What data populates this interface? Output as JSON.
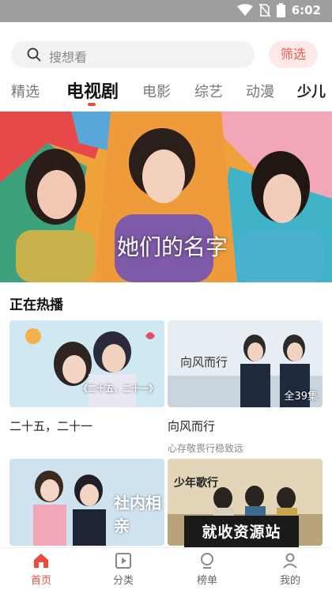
{
  "status_bar": {
    "time": "6:02"
  },
  "search": {
    "placeholder": "搜想看",
    "filter_label": "筛选"
  },
  "tabs": [
    "精选",
    "电视剧",
    "电影",
    "综艺",
    "动漫",
    "少儿"
  ],
  "active_tab": "电视剧",
  "banner": {
    "title_text": "她们的名字"
  },
  "section": {
    "title": "正在热播"
  },
  "cards": [
    {
      "title": "二十五，二十一",
      "subtitle": "",
      "poster_text": "《二十五，二十一》",
      "badge": ""
    },
    {
      "title": "向风而行",
      "subtitle": "心存敬畏行稳致远",
      "poster_text": "向风而行",
      "badge": "全39集"
    },
    {
      "title": "",
      "subtitle": "",
      "poster_text": "社内相亲",
      "badge": ""
    },
    {
      "title": "",
      "subtitle": "",
      "poster_text": "少年歌行",
      "badge": ""
    }
  ],
  "watermark": "就收资源站",
  "bottom_nav": [
    {
      "label": "首页",
      "icon": "home-icon",
      "active": true
    },
    {
      "label": "分类",
      "icon": "category-icon",
      "active": false
    },
    {
      "label": "榜单",
      "icon": "ranking-icon",
      "active": false
    },
    {
      "label": "我的",
      "icon": "profile-icon",
      "active": false
    }
  ],
  "colors": {
    "accent": "#ec4b3f",
    "status_bar": "#9e9e9e",
    "search_bg": "#f2f2f2",
    "filter_bg": "#fde9e8"
  }
}
